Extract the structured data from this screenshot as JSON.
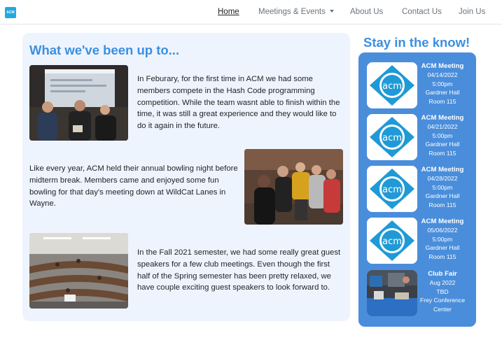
{
  "nav": {
    "logo_text": "ACM",
    "links": {
      "home": "Home",
      "meetings": "Meetings & Events",
      "about": "About Us",
      "contact": "Contact Us",
      "join": "Join Us"
    }
  },
  "updates": {
    "title": "What we've been up to...",
    "items": [
      {
        "text": "In Feburary, for the first time in ACM we had some members compete in the Hash Code programming competition. While the team wasnt able to finish within the time, it was still a great experience and they would like to do it again in the future."
      },
      {
        "text": "Like every year, ACM held their annual bowling night before midterm break. Members came and enjoyed some fun bowling for that day's meeting down at WildCat Lanes in Wayne."
      },
      {
        "text": "In the Fall 2021 semester, we had some really great guest speakers for a few club meetings. Even though the first half of the Spring semester has been pretty relaxed, we have couple exciting guest speakers to look forward to."
      }
    ]
  },
  "events": {
    "title": "Stay in the know!",
    "items": [
      {
        "name": "ACM Meeting",
        "date": "04/14/2022",
        "time": "5:00pm",
        "place": "Gardner Hall",
        "room": "Room 115"
      },
      {
        "name": "ACM Meeting",
        "date": "04/21/2022",
        "time": "5:00pm",
        "place": "Gardner Hall",
        "room": "Room 115"
      },
      {
        "name": "ACM Meeting",
        "date": "04/28/2022",
        "time": "5:00pm",
        "place": "Gardner Hall",
        "room": "Room 115"
      },
      {
        "name": "ACM Meeting",
        "date": "05/06/2022",
        "time": "5:00pm",
        "place": "Gardner Hall",
        "room": "Room 115"
      },
      {
        "name": "Club Fair",
        "date": "Aug 2022",
        "time": "TBD",
        "place": "Frey Conference",
        "room": "Center"
      }
    ]
  },
  "colors": {
    "accent": "#3b8fe0",
    "sidebar": "#4a8edb",
    "panel": "#eef4fd",
    "logo": "#21a9e1"
  }
}
